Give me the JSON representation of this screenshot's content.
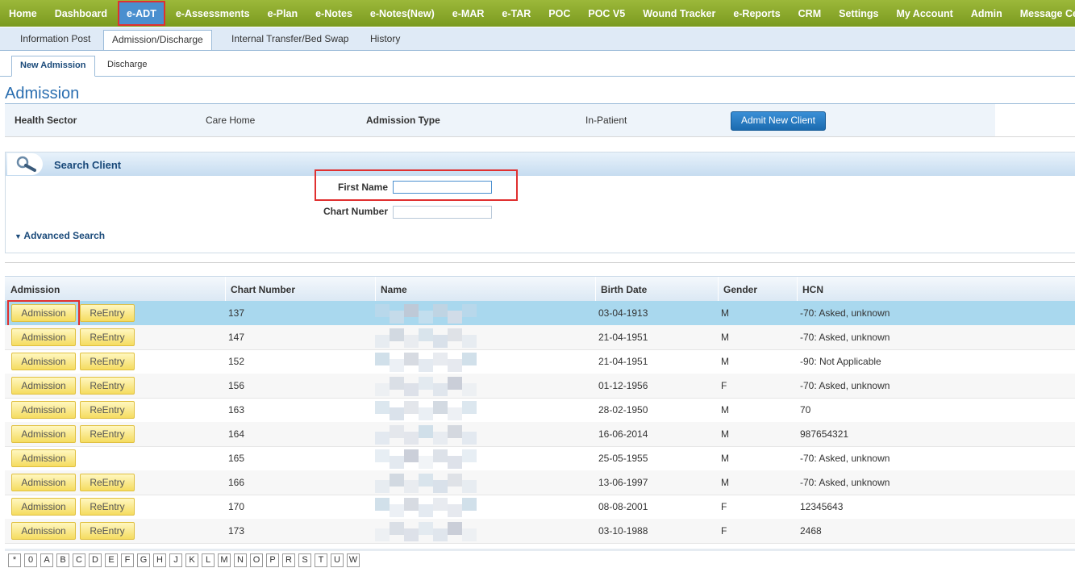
{
  "top_nav": [
    "Home",
    "Dashboard",
    "e-ADT",
    "e-Assessments",
    "e-Plan",
    "e-Notes",
    "e-Notes(New)",
    "e-MAR",
    "e-TAR",
    "POC",
    "POC V5",
    "Wound Tracker",
    "e-Reports",
    "CRM",
    "Settings",
    "My Account",
    "Admin",
    "Message Center"
  ],
  "sub_nav": [
    "Information Post",
    "Admission/Discharge",
    "Internal Transfer/Bed Swap",
    "History"
  ],
  "tertiary_tabs": [
    "New Admission",
    "Discharge"
  ],
  "page_title": "Admission",
  "admission_bar": {
    "health_sector_label": "Health Sector",
    "health_sector_value": "Care Home",
    "admission_type_label": "Admission Type",
    "admission_type_value": "In-Patient",
    "admit_button": "Admit New Client"
  },
  "search": {
    "title": "Search Client",
    "first_name_label": "First Name",
    "chart_number_label": "Chart Number",
    "advanced_search": "Advanced Search"
  },
  "table": {
    "headers": [
      "Admission",
      "Chart Number",
      "Name",
      "Birth Date",
      "Gender",
      "HCN"
    ],
    "admission_button": "Admission",
    "reentry_button": "ReEntry",
    "rows": [
      {
        "chart": "137",
        "birth": "03-04-1913",
        "gender": "M",
        "hcn": "-70: Asked, unknown",
        "reentry": true
      },
      {
        "chart": "147",
        "birth": "21-04-1951",
        "gender": "M",
        "hcn": "-70: Asked, unknown",
        "reentry": true
      },
      {
        "chart": "152",
        "birth": "21-04-1951",
        "gender": "M",
        "hcn": "-90: Not Applicable",
        "reentry": true
      },
      {
        "chart": "156",
        "birth": "01-12-1956",
        "gender": "F",
        "hcn": "-70: Asked, unknown",
        "reentry": true
      },
      {
        "chart": "163",
        "birth": "28-02-1950",
        "gender": "M",
        "hcn": "70",
        "reentry": true
      },
      {
        "chart": "164",
        "birth": "16-06-2014",
        "gender": "M",
        "hcn": "987654321",
        "reentry": true
      },
      {
        "chart": "165",
        "birth": "25-05-1955",
        "gender": "M",
        "hcn": "-70: Asked, unknown",
        "reentry": false
      },
      {
        "chart": "166",
        "birth": "13-06-1997",
        "gender": "M",
        "hcn": "-70: Asked, unknown",
        "reentry": true
      },
      {
        "chart": "170",
        "birth": "08-08-2001",
        "gender": "F",
        "hcn": "12345643",
        "reentry": true
      },
      {
        "chart": "173",
        "birth": "03-10-1988",
        "gender": "F",
        "hcn": "2468",
        "reentry": true
      }
    ]
  },
  "alphabet": [
    "*",
    "0",
    "A",
    "B",
    "C",
    "D",
    "E",
    "F",
    "G",
    "H",
    "J",
    "K",
    "L",
    "M",
    "N",
    "O",
    "P",
    "R",
    "S",
    "T",
    "U",
    "W"
  ],
  "colors": {
    "nav_green": "#8aaa2c",
    "active_blue": "#4a8fcf",
    "highlight_red": "#e03030",
    "selected_row": "#a9d8ee",
    "button_yellow": "#f5dc60"
  }
}
